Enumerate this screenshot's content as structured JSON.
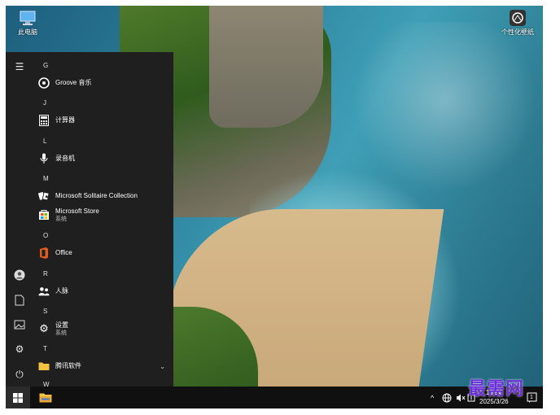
{
  "desktop": {
    "icons": [
      {
        "label": "此电脑",
        "icon": "computer-icon"
      },
      {
        "label": "个性化壁纸",
        "icon": "wallpaper-icon"
      }
    ]
  },
  "start_menu": {
    "rail_icons": [
      "hamburger-icon",
      "user-icon",
      "document-icon",
      "pictures-icon",
      "settings-icon",
      "power-icon"
    ],
    "sections": [
      {
        "letter": "G",
        "apps": [
          {
            "name": "Groove 音乐",
            "icon": "groove-icon"
          }
        ]
      },
      {
        "letter": "J",
        "apps": [
          {
            "name": "计算器",
            "icon": "calculator-icon"
          }
        ]
      },
      {
        "letter": "L",
        "apps": [
          {
            "name": "录音机",
            "icon": "microphone-icon"
          }
        ]
      },
      {
        "letter": "M",
        "apps": [
          {
            "name": "Microsoft Solitaire Collection",
            "icon": "cards-icon"
          },
          {
            "name": "Microsoft Store",
            "sub": "系统",
            "icon": "store-icon"
          }
        ]
      },
      {
        "letter": "O",
        "apps": [
          {
            "name": "Office",
            "icon": "office-icon"
          }
        ]
      },
      {
        "letter": "R",
        "apps": [
          {
            "name": "人脉",
            "icon": "people-icon"
          }
        ]
      },
      {
        "letter": "S",
        "apps": [
          {
            "name": "设置",
            "sub": "系统",
            "icon": "gear-icon"
          }
        ]
      },
      {
        "letter": "T",
        "apps": [
          {
            "name": "腾讯软件",
            "icon": "folder-icon",
            "expandable": true
          }
        ]
      },
      {
        "letter": "W",
        "apps": []
      }
    ]
  },
  "taskbar": {
    "tray_chevron": "^",
    "time": "10:54",
    "date": "2025/3/26",
    "notification_count": "1"
  },
  "watermark": "最需网",
  "colors": {
    "start_bg": "#1f1f1f",
    "taskbar_bg": "#101010",
    "office_orange": "#e35b1a",
    "store_blue": "#0f78d4",
    "folder_yellow": "#f5c242"
  }
}
